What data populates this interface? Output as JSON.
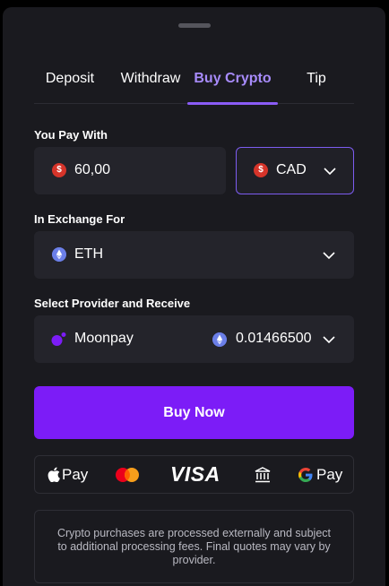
{
  "tabs": [
    {
      "label": "Deposit",
      "active": false
    },
    {
      "label": "Withdraw",
      "active": false
    },
    {
      "label": "Buy Crypto",
      "active": true
    },
    {
      "label": "Tip",
      "active": false
    }
  ],
  "pay": {
    "label": "You Pay With",
    "amount": "60,00",
    "currency": "CAD",
    "currency_icon": "dollar-coin-icon"
  },
  "exchange": {
    "label": "In Exchange For",
    "asset": "ETH",
    "asset_icon": "ethereum-icon"
  },
  "provider": {
    "label": "Select Provider and Receive",
    "name": "Moonpay",
    "receive_amount": "0.01466500",
    "provider_icon": "moonpay-icon"
  },
  "buy_button": {
    "label": "Buy Now"
  },
  "payment_methods": {
    "apple_pay": "Pay",
    "visa": "VISA",
    "google_pay": "Pay",
    "icons": [
      "apple-pay-icon",
      "mastercard-icon",
      "visa-icon",
      "bank-icon",
      "google-pay-icon"
    ]
  },
  "notice": "Crypto purchases are processed externally and subject to additional processing fees. Final quotes may vary by provider.",
  "colors": {
    "accent": "#8b5cf6",
    "button": "#7c1cf7",
    "panel": "#1a1a1f",
    "field": "#24242b"
  }
}
